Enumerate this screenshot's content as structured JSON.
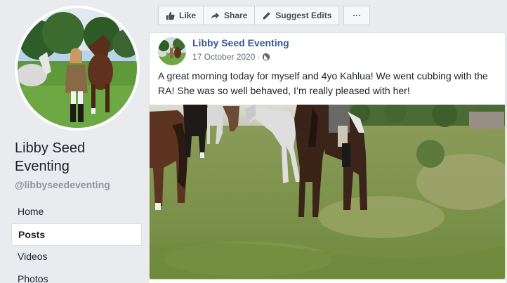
{
  "sidebar": {
    "page_name": "Libby Seed Eventing",
    "handle": "@libbyseedeventing",
    "nav": [
      {
        "label": "Home"
      },
      {
        "label": "Posts"
      },
      {
        "label": "Videos"
      },
      {
        "label": "Photos"
      }
    ],
    "active_nav": "Posts"
  },
  "actions": {
    "like_label": "Like",
    "share_label": "Share",
    "suggest_label": "Suggest Edits",
    "more_label": "···"
  },
  "post": {
    "author": "Libby Seed Eventing",
    "date": "17 October 2020",
    "separator": "·",
    "privacy_icon": "globe-icon",
    "text": "A great morning today for myself and 4yo Kahlua! We went cubbing with the RA! She was so well behaved, I’m really pleased with her!"
  },
  "colors": {
    "link_blue": "#365899",
    "background": "#e9ebee",
    "card": "#ffffff"
  }
}
